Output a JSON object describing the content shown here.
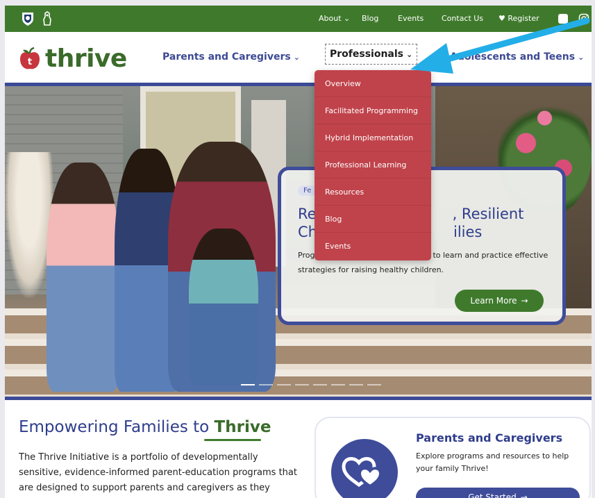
{
  "topbar": {
    "links": [
      "About",
      "Blog",
      "Events",
      "Contact Us",
      "Register"
    ],
    "about_caret": "⌄",
    "register_icon": "heart-icon",
    "bg_color": "#3f7a2c"
  },
  "brand": {
    "logo_text": "thrive",
    "logo_icon": "apple-icon"
  },
  "nav": {
    "parents": "Parents and Caregivers",
    "professionals": "Professionals",
    "teens": "Adolescents and Teens",
    "caret": "⌄",
    "accent_color": "#3d4a94"
  },
  "dropdown": {
    "items": [
      "Overview",
      "Facilitated Programming",
      "Hybrid Implementation",
      "Professional Learning",
      "Resources",
      "Blog",
      "Events"
    ],
    "bg_color": "#c0434b"
  },
  "feature": {
    "tag": "Fe",
    "title": "Re              , Resilient Ch              ilies",
    "title_line1": "Re",
    "title_line1b": ", Resilient",
    "title_line2": "Ch",
    "title_line2b": "ilies",
    "desc_line1a": "Prog",
    "desc_line1b": "to learn and practice effective",
    "desc_line2": "strategies for raising healthy children.",
    "button": "Learn More",
    "arrow": "→"
  },
  "intro": {
    "title_prefix": "Empowering Families to ",
    "title_highlight": "Thrive",
    "body": "The Thrive Initiative is a portfolio of developmentally sensitive, evidence-informed parent-education programs that are designed to support parents and caregivers as they"
  },
  "parents_card": {
    "title": "Parents and Caregivers",
    "desc": "Explore programs and resources to help your family Thrive!",
    "button": "Get Started",
    "arrow": "→"
  }
}
